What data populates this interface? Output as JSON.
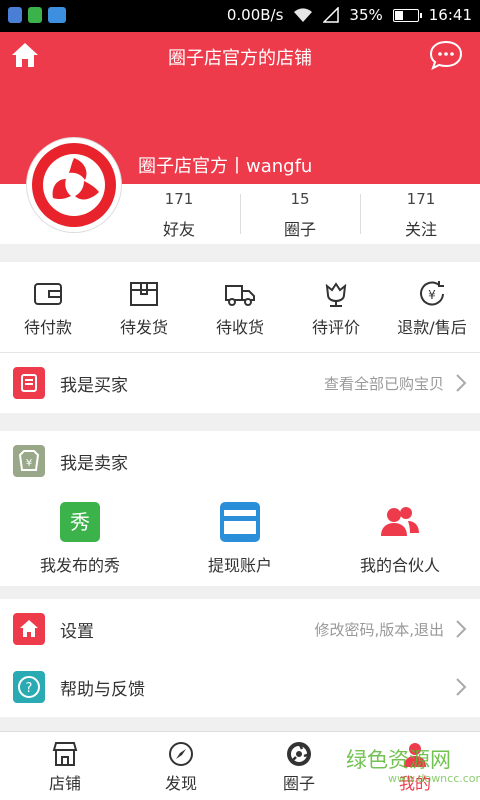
{
  "status_bar": {
    "network_speed": "0.00B/s",
    "battery": "35%",
    "time": "16:41",
    "battery_level": 0.35
  },
  "header": {
    "title": "圈子店官方的店铺",
    "shop_name": "圈子店官方丨wangfu"
  },
  "stats": [
    {
      "value": "171",
      "label": "好友"
    },
    {
      "value": "15",
      "label": "圈子"
    },
    {
      "value": "171",
      "label": "关注"
    }
  ],
  "orders": [
    {
      "label": "待付款",
      "icon": "wallet-icon"
    },
    {
      "label": "待发货",
      "icon": "box-icon"
    },
    {
      "label": "待收货",
      "icon": "truck-icon"
    },
    {
      "label": "待评价",
      "icon": "flower-icon"
    },
    {
      "label": "退款/售后",
      "icon": "refund-icon"
    }
  ],
  "buyer": {
    "label": "我是买家",
    "link": "查看全部已购宝贝"
  },
  "seller": {
    "label": "我是卖家",
    "items": [
      {
        "label": "我发布的秀",
        "icon": "show-icon",
        "icon_text": "秀"
      },
      {
        "label": "提现账户",
        "icon": "card-icon"
      },
      {
        "label": "我的合伙人",
        "icon": "partners-icon"
      }
    ]
  },
  "settings": {
    "label": "设置",
    "detail": "修改密码,版本,退出"
  },
  "help": {
    "label": "帮助与反馈"
  },
  "tabs": [
    {
      "label": "店铺",
      "icon": "store-icon"
    },
    {
      "label": "发现",
      "icon": "compass-icon"
    },
    {
      "label": "圈子",
      "icon": "circle-icon"
    },
    {
      "label": "我的",
      "icon": "user-icon"
    }
  ],
  "watermark": {
    "text": "绿色资源网",
    "sub": "www.downcc.com"
  },
  "colors": {
    "brand_red": "#ee3b4c",
    "seller_olive": "#9aa88a",
    "show_green": "#3cb34a",
    "card_blue": "#2a8fd8",
    "help_teal": "#2aaab2"
  }
}
